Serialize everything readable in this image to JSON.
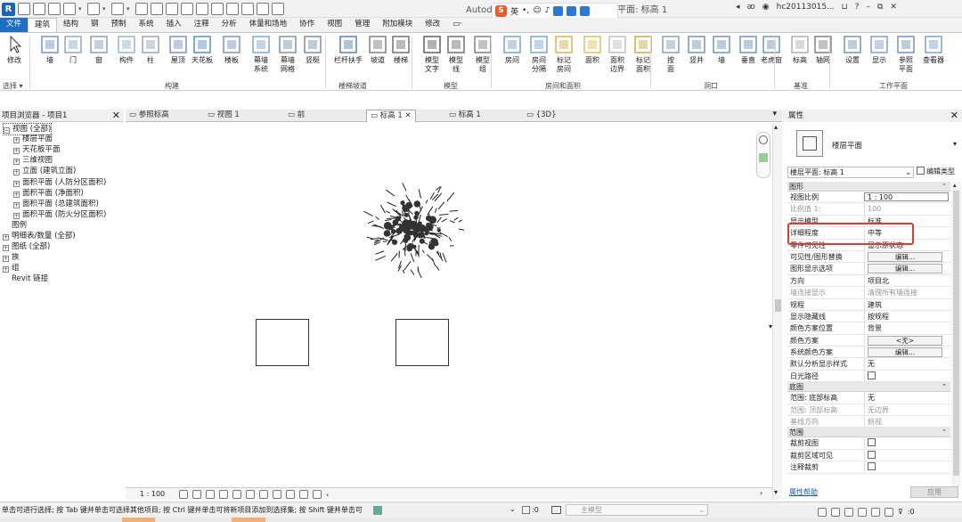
{
  "app": {
    "title": "Autodesk Revit 2022 - 项目1 - 楼层平面: 标高 1",
    "user": "hc20113015...",
    "app_icon_letter": "R",
    "ime_label": "英"
  },
  "ribbon_tabs": [
    "文件",
    "建筑",
    "结构",
    "钢",
    "预制",
    "系统",
    "插入",
    "注释",
    "分析",
    "体量和场地",
    "协作",
    "视图",
    "管理",
    "附加模块",
    "修改",
    "▭·"
  ],
  "ribbon_active_tab": "建筑",
  "ribbon": {
    "select_group": "选择",
    "modify": "修改",
    "tools": [
      "墙",
      "门",
      "窗",
      "构件",
      "柱",
      "屋顶",
      "天花板",
      "楼板",
      "幕墙\n系统",
      "幕墙\n网格",
      "竖梃",
      "栏杆扶手",
      "坡道",
      "楼梯",
      "模型\n文字",
      "模型\n线",
      "模型\n组",
      "房间",
      "房间\n分隔",
      "标记\n房间",
      "面积",
      "面积\n边界",
      "标记\n面积",
      "按\n面",
      "竖井",
      "墙",
      "垂直",
      "老虎窗",
      "标高",
      "轴网",
      "设置",
      "显示",
      "参照\n平面",
      "查看器"
    ],
    "groups": [
      "构建",
      "楼梯坡道",
      "模型",
      "房间和面积",
      "洞口",
      "基准",
      "工作平面"
    ]
  },
  "project_browser": {
    "title": "项目浏览器 - 项目1",
    "items": [
      {
        "label": "视图 (全部)",
        "level": 0,
        "expanded": true,
        "selected": true
      },
      {
        "label": "楼层平面",
        "level": 1
      },
      {
        "label": "天花板平面",
        "level": 1
      },
      {
        "label": "三维视图",
        "level": 1
      },
      {
        "label": "立面 (建筑立面)",
        "level": 1
      },
      {
        "label": "面积平面 (人防分区面积)",
        "level": 1
      },
      {
        "label": "面积平面 (净面积)",
        "level": 1
      },
      {
        "label": "面积平面 (总建筑面积)",
        "level": 1
      },
      {
        "label": "面积平面 (防火分区面积)",
        "level": 1
      },
      {
        "label": "图例",
        "level": 0,
        "noexp": true
      },
      {
        "label": "明细表/数量 (全部)",
        "level": 0
      },
      {
        "label": "图纸 (全部)",
        "level": 0
      },
      {
        "label": "族",
        "level": 0
      },
      {
        "label": "组",
        "level": 0
      },
      {
        "label": "Revit 链接",
        "level": 0,
        "noexp": true
      }
    ]
  },
  "view_tabs": [
    {
      "label": "参照标高",
      "active": false
    },
    {
      "label": "视图 1",
      "active": false
    },
    {
      "label": "前",
      "active": false
    },
    {
      "label": "标高 1",
      "active": true
    },
    {
      "label": "标高 1",
      "active": false
    },
    {
      "label": "{3D}",
      "active": false
    }
  ],
  "view_bar": {
    "scale": "1 : 100"
  },
  "properties": {
    "title": "属性",
    "type_name": "楼层平面",
    "type_selector": "楼层平面: 标高 1",
    "edit_type": "编辑类型",
    "sections": [
      {
        "title": "图形",
        "rows": [
          {
            "k": "视图比例",
            "v": "1 : 100",
            "kind": "input"
          },
          {
            "k": "比例值 1:",
            "v": "100",
            "gray": true
          },
          {
            "k": "显示模型",
            "v": "标准"
          },
          {
            "k": "详细程度",
            "v": "中等"
          },
          {
            "k": "零件可见性",
            "v": "显示原状态"
          },
          {
            "k": "可见性/图形替换",
            "v": "编辑...",
            "kind": "button"
          },
          {
            "k": "图形显示选项",
            "v": "编辑...",
            "kind": "button"
          },
          {
            "k": "方向",
            "v": "项目北"
          },
          {
            "k": "墙连接显示",
            "v": "清理所有墙连接",
            "gray": true
          },
          {
            "k": "规程",
            "v": "建筑"
          },
          {
            "k": "显示隐藏线",
            "v": "按规程"
          },
          {
            "k": "颜色方案位置",
            "v": "背景"
          },
          {
            "k": "颜色方案",
            "v": "<无>",
            "kind": "button"
          },
          {
            "k": "系统颜色方案",
            "v": "编辑...",
            "kind": "button"
          },
          {
            "k": "默认分析显示样式",
            "v": "无"
          },
          {
            "k": "日光路径",
            "v": "",
            "kind": "checkbox"
          }
        ]
      },
      {
        "title": "底图",
        "rows": [
          {
            "k": "范围: 底部标高",
            "v": "无"
          },
          {
            "k": "范围: 顶部标高",
            "v": "无边界",
            "gray": true
          },
          {
            "k": "基线方向",
            "v": "俯视",
            "gray": true
          }
        ]
      },
      {
        "title": "范围",
        "rows": [
          {
            "k": "裁剪视图",
            "v": "",
            "kind": "checkbox"
          },
          {
            "k": "裁剪区域可见",
            "v": "",
            "kind": "checkbox"
          },
          {
            "k": "注释裁剪",
            "v": "",
            "kind": "checkbox"
          }
        ]
      }
    ],
    "help": "属性帮助",
    "apply": "应用"
  },
  "status": {
    "text": "单击可进行选择; 按 Tab 键并单击可选择其他项目; 按 Ctrl 键并单击可将新项目添加到选择集; 按 Shift 键并单击可",
    "workset_count": ":0",
    "model": "主模型",
    "filter_count": ":0"
  },
  "colors": {
    "accent": "#1e6fc4",
    "highlight": "#e23a2e"
  }
}
